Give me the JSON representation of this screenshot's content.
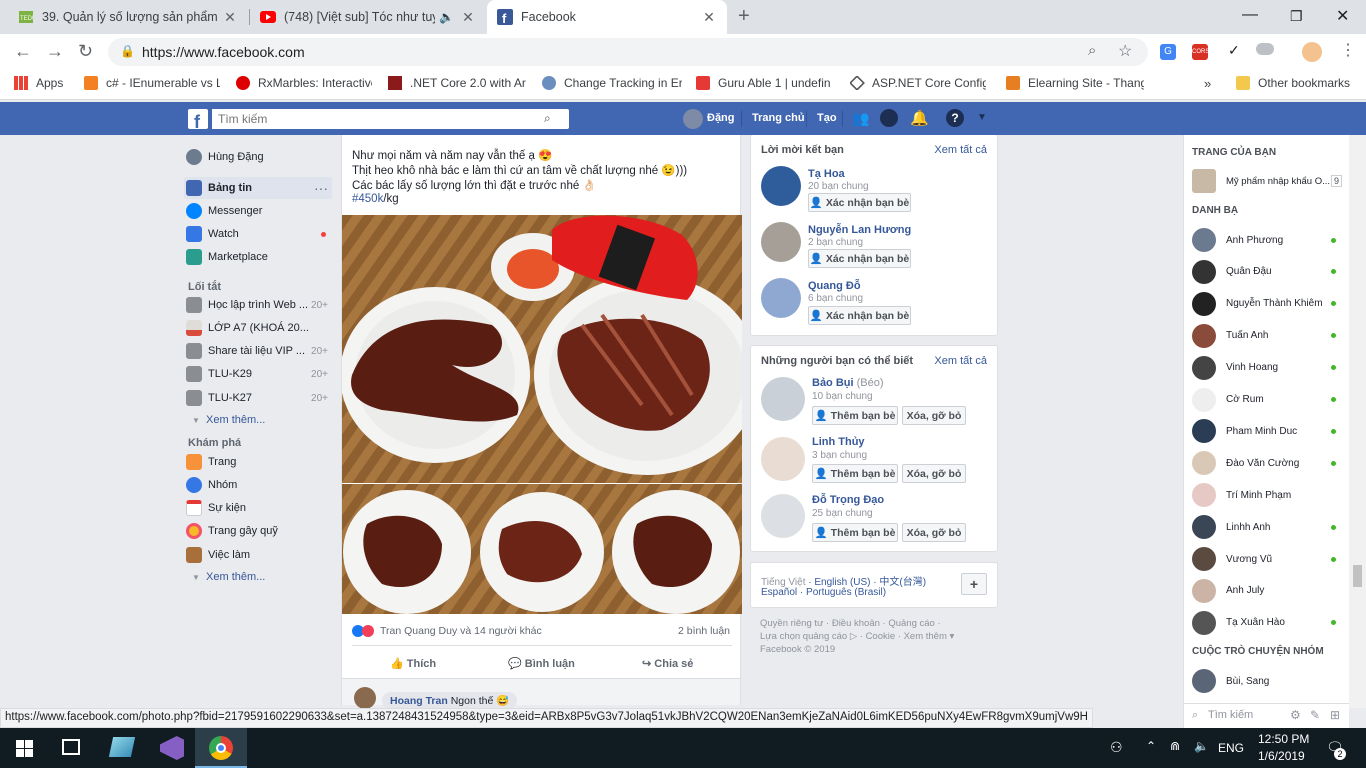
{
  "browser": {
    "tabs": [
      {
        "title": "39. Quản lý số lượng sản phẩm",
        "icon": "tedu-icon"
      },
      {
        "title": "(748) [Việt sub] Tóc như tuyết",
        "icon": "youtube-icon"
      },
      {
        "title": "Facebook",
        "icon": "facebook-icon"
      }
    ],
    "url": "https://www.facebook.com",
    "bookmarks": [
      "Apps",
      "c# - IEnumerable vs L",
      "RxMarbles: Interactive",
      ".NET Core 2.0 with Ar",
      "Change Tracking in Er",
      "Guru Able 1 | undefin",
      "ASP.NET Core Config",
      "Elearning Site - Thang"
    ],
    "other_bookmarks": "Other bookmarks",
    "chevron": "»"
  },
  "fb": {
    "search_placeholder": "Tìm kiếm",
    "header": {
      "user": "Đặng",
      "home": "Trang chủ",
      "create": "Tạo"
    },
    "left_nav": {
      "profile": "Hùng Đặng",
      "items": [
        "Bảng tin",
        "Messenger",
        "Watch",
        "Marketplace"
      ],
      "shortcuts_title": "Lối tắt",
      "shortcuts": [
        {
          "label": "Học lập trình Web ...",
          "count": "20+"
        },
        {
          "label": "LỚP A7 (KHOÁ 20...",
          "count": ""
        },
        {
          "label": "Share tài liệu VIP ...",
          "count": "20+"
        },
        {
          "label": "TLU-K29",
          "count": "20+"
        },
        {
          "label": "TLU-K27",
          "count": "20+"
        }
      ],
      "see_more_1": "Xem thêm...",
      "explore_title": "Khám phá",
      "explore": [
        "Trang",
        "Nhóm",
        "Sự kiện",
        "Trang gây quỹ",
        "Việc làm"
      ],
      "see_more_2": "Xem thêm..."
    },
    "post": {
      "lines": [
        "Như mọi năm và năm nay vẫn thế ạ 😍",
        "Thịt heo khô nhà bác e làm thì cứ an tâm về chất lượng nhé 😉)))",
        "Các bác lấy số lượng lớn thì đặt e trước nhé 👌🏻"
      ],
      "hashtag": "#450k",
      "hashtag_suffix": "/kg",
      "reactions": "Tran Quang Duy và 14 người khác",
      "comment_count": "2 bình luận",
      "like": "Thích",
      "comment": "Bình luận",
      "share": "Chia sẻ",
      "comment_author": "Hoang Tran",
      "comment_text": "Ngon thế 😅"
    },
    "requests": {
      "title": "Lời mời kết bạn",
      "see_all": "Xem tất cả",
      "items": [
        {
          "name": "Tạ Hoa",
          "mutual": "20 bạn chung",
          "btn": "Xác nhận bạn bè"
        },
        {
          "name": "Nguyễn Lan Hương",
          "mutual": "2 bạn chung",
          "btn": "Xác nhận bạn bè"
        },
        {
          "name": "Quang Đỗ",
          "mutual": "6 bạn chung",
          "btn": "Xác nhận bạn bè"
        }
      ]
    },
    "pymk": {
      "title": "Những người bạn có thể biết",
      "see_all": "Xem tất cả",
      "items": [
        {
          "name": "Bảo Bụi",
          "extra": "(Béo)",
          "mutual": "10 bạn chung",
          "add": "Thêm bạn bè",
          "remove": "Xóa, gỡ bỏ"
        },
        {
          "name": "Linh Thủy",
          "extra": "",
          "mutual": "3 bạn chung",
          "add": "Thêm bạn bè",
          "remove": "Xóa, gỡ bỏ"
        },
        {
          "name": "Đỗ Trọng Đạo",
          "extra": "",
          "mutual": "25 bạn chung",
          "add": "Thêm bạn bè",
          "remove": "Xóa, gỡ bỏ"
        }
      ]
    },
    "languages": {
      "line1": [
        "Tiếng Việt",
        "English (US)",
        "中文(台灣)"
      ],
      "line2": [
        "Español",
        "Português (Brasil)"
      ]
    },
    "footer": {
      "line1": "Quyền riêng tư · Điều khoản · Quảng cáo ·",
      "line2": "Lựa chọn quảng cáo ▷ · Cookie · Xem thêm ▾",
      "line3": "Facebook © 2019"
    },
    "chat": {
      "pages_title": "TRANG CỦA BẠN",
      "page": "Mỹ phẩm nhập khẩu O...",
      "page_badge": "9",
      "friends_title": "DANH BẠ",
      "friends": [
        "Anh Phương",
        "Quân Đậu",
        "Nguyễn Thành Khiêm",
        "Tuấn Anh",
        "Vinh Hoang",
        "Cờ Rum",
        "Pham Minh Duc",
        "Đào Văn Cường",
        "Trí Minh Phạm",
        "Linhh Anh",
        "Vương Vũ",
        "Anh July",
        "Tạ Xuân Hào"
      ],
      "groups_title": "CUỘC TRÒ CHUYỆN NHÓM",
      "group": "Bùi, Sang",
      "search_placeholder": "Tìm kiếm"
    }
  },
  "status_url": "https://www.facebook.com/photo.php?fbid=2179591602290633&set=a.1387248431524958&type=3&eid=ARBx8P5vG3v7Jolaq51vkJBhV2CQW20ENan3emKjeZaNAid0L6imKED56puNXy4EwFR8gvmX9umjVw9H",
  "taskbar": {
    "lang": "ENG",
    "time": "12:50 PM",
    "date": "1/6/2019",
    "notif": "2"
  },
  "colors": {
    "fb_blue": "#4267b2",
    "online": "#42b72a",
    "link": "#365899"
  }
}
